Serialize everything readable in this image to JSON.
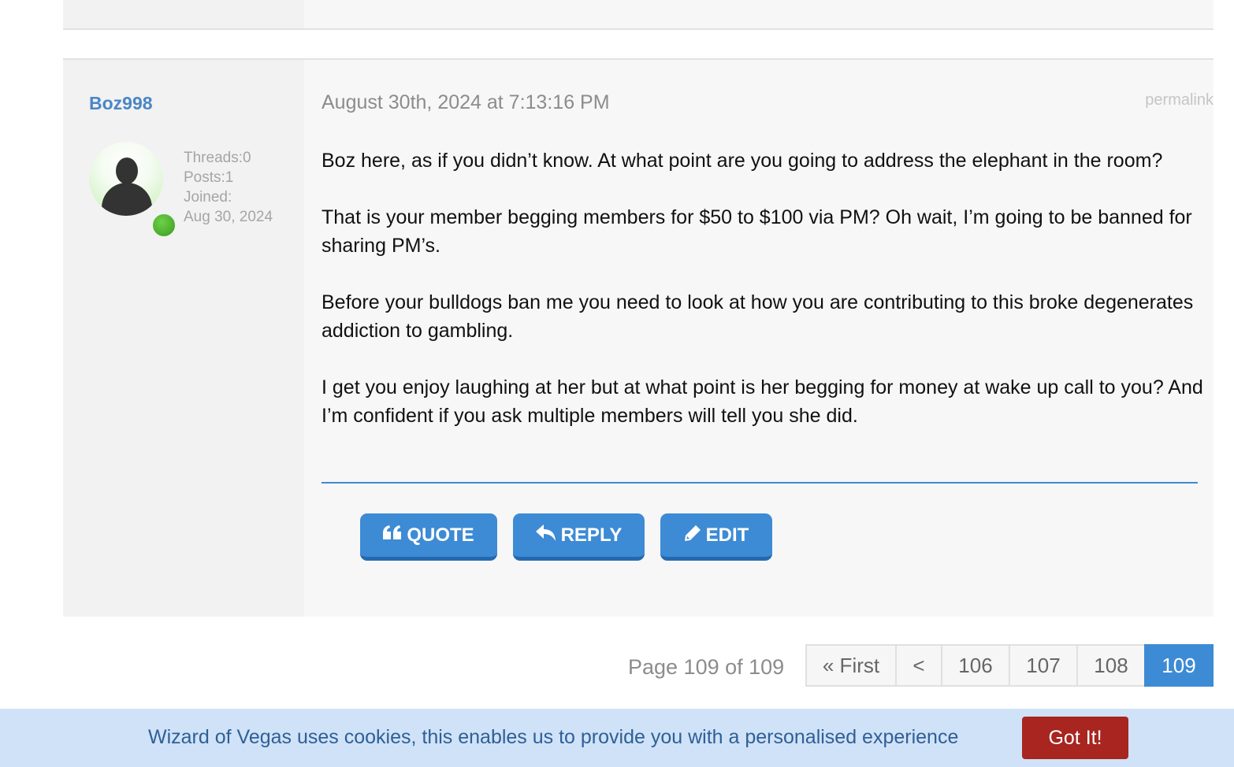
{
  "post": {
    "username": "Boz998",
    "stats": {
      "threads": "Threads:0",
      "posts": "Posts:1",
      "joined_label": "Joined:",
      "joined_date": "Aug 30, 2024"
    },
    "date": "August 30th, 2024 at 7:13:16 PM",
    "permalink": "permalink",
    "paragraphs": [
      "Boz here, as if you didn’t know. At what point are you going to address the elephant in the room?",
      "That is your member begging members for $50 to $100 via PM? Oh wait, I’m going to be banned for sharing PM’s.",
      "Before your bulldogs ban me you need to look at how you are contributing to this broke degenerates addiction to gambling.",
      "I get you enjoy laughing at her but at what point is her begging for money at wake up call to you? And I’m confident if you ask multiple members will tell you she did."
    ],
    "buttons": {
      "quote": "QUOTE",
      "reply": "REPLY",
      "edit": "EDIT"
    },
    "icons": {
      "quote": "quote-icon",
      "reply": "reply-arrow-icon",
      "edit": "pencil-icon"
    }
  },
  "pagination": {
    "label": "Page 109 of 109",
    "first": "« First",
    "prev": "<",
    "pages": [
      "106",
      "107",
      "108",
      "109"
    ],
    "current": "109"
  },
  "cookie": {
    "text": "Wizard of Vegas uses cookies, this enables us to provide you with a personalised experience",
    "button": "Got It!"
  },
  "colors": {
    "accent": "#3d8bd5",
    "username": "#4a86c5",
    "cookie_bg": "#cfe2f7",
    "cookie_button": "#a82520"
  }
}
